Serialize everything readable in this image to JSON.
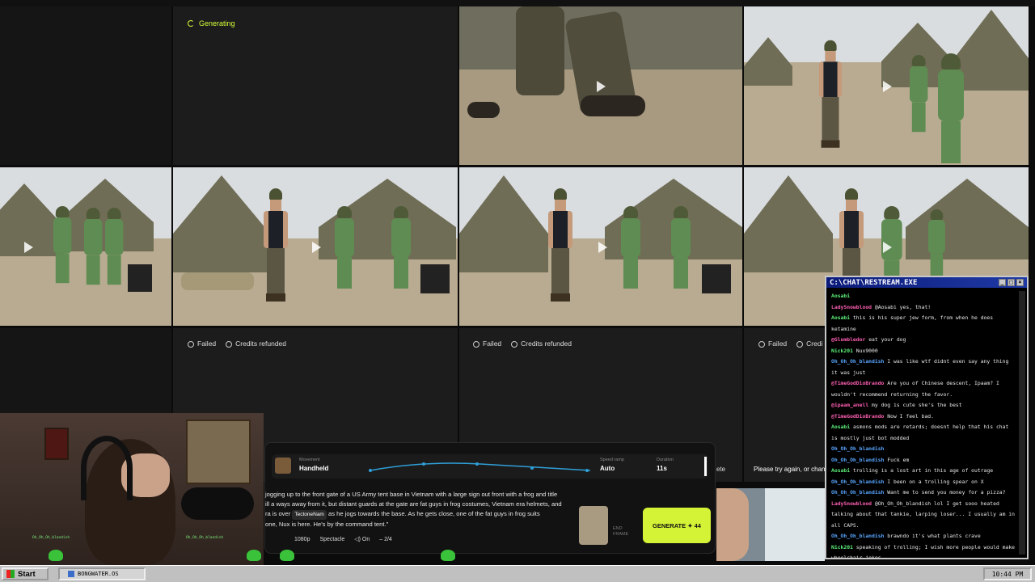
{
  "grid": {
    "generating_label": "Generating",
    "failed_label": "Failed",
    "refunded_label": "Credits refunded",
    "retry_text": "Please try again, or chan",
    "delete_fragment": "ete",
    "cut_credits": "Credi"
  },
  "chat": {
    "title": "C:\\CHAT\\RESTREAM.EXE",
    "messages": [
      {
        "user": "Aosabi",
        "text": ""
      },
      {
        "user": "LadySnowblood",
        "text": "@Aosabi yes, that!"
      },
      {
        "user": "Aosabi",
        "text": "this is his super jew form, from when he does ketamine"
      },
      {
        "user": "@Glumbledor",
        "text": "eat your dog"
      },
      {
        "user": "Nick201",
        "text": "Nux9000"
      },
      {
        "user": "Oh_Oh_Oh_blandish",
        "text": "I was like wtf didnt even say any thing it was just"
      },
      {
        "user": "@TimeGodDioBrando",
        "text": "Are you of Chinese descent, Ipaam? I wouldn't recommend returning the favor."
      },
      {
        "user": "@ipaam_anell",
        "text": "my dog is cute she's the best"
      },
      {
        "user": "@TimeGodDioBrando",
        "text": "Now I feel bad."
      },
      {
        "user": "Aosabi",
        "text": "asmons mods are retards; doesnt help that his chat is mostly just bot modded"
      },
      {
        "user": "Oh_Oh_Oh_blandish",
        "text": ""
      },
      {
        "user": "Oh_Oh_Oh_blandish",
        "text": "Fuck em"
      },
      {
        "user": "Aosabi",
        "text": "trolling is a lost art in this age of outrage"
      },
      {
        "user": "Oh_Oh_Oh_blandish",
        "text": "I been on a trolling spear on X"
      },
      {
        "user": "Oh_Oh_Oh_blandish",
        "text": "Want me to send you money for a pizza?"
      },
      {
        "user": "LadySnowblood",
        "text": "@Oh_Oh_Oh_blandish lol I get sooo heated talking about that tankie, larping loser... I usually am in all CAPS."
      },
      {
        "user": "Oh_Oh_Oh_blandish",
        "text": "brawndo it's what plants crave"
      },
      {
        "user": "Nick201",
        "text": "speaking of trolling; I wish more people would make wheelchair jokes"
      }
    ]
  },
  "panel": {
    "movement_label": "Movement",
    "movement_value": "Handheld",
    "speed_label": "Speed ramp",
    "speed_value": "Auto",
    "duration_label": "Duration",
    "duration_value": "11s",
    "prompt_line1": " jogging up to the front gate of a US Army tent base in Vietnam with a large sign out front with a frog and title",
    "prompt_line2": "ill a ways away from it, but distant guards at the gate are fat guys in frog costumes, Vietnam era helmets, and",
    "prompt_line3a": "ra is over",
    "prompt_chip": "TectoneNam",
    "prompt_line3b": "as he jogs towards the base. As he gets close, one of the fat guys in frog suits",
    "prompt_line4": "one, Nux is here. He's by the command tent.\"",
    "resolution": "1080p",
    "style": "Spectacle",
    "audio": "On",
    "count": "2/4",
    "end_frame_label": "END FRAME",
    "generate_label": "GENERATE",
    "generate_cost": "44"
  },
  "webcam": {
    "overlay_user1": "Oh_Oh_Oh_blandish",
    "overlay_user2": "Oh_Oh_Oh_blandish"
  },
  "taskbar": {
    "start": "Start",
    "window": "BONGWATER.OS",
    "clock": "10:44 PM"
  }
}
